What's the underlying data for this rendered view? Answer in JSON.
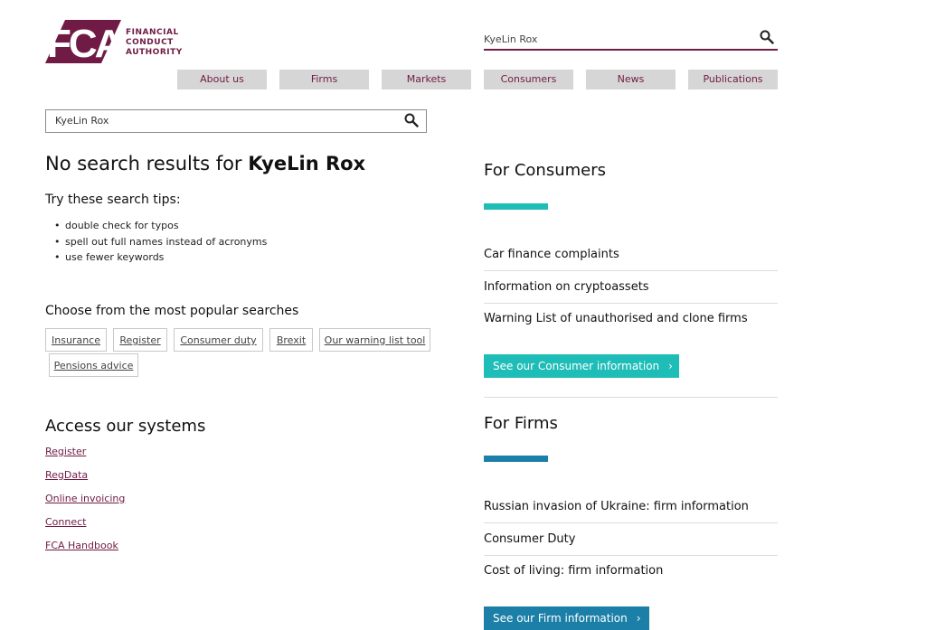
{
  "logo": {
    "mark_text": "FCA",
    "lines": [
      "FINANCIAL",
      "CONDUCT",
      "AUTHORITY"
    ]
  },
  "colors": {
    "brand": "#701b45",
    "consumers_accent": "#1fbdb8",
    "firms_accent": "#1b7fa8",
    "nav_bg": "#d6d6d6"
  },
  "header_search": {
    "value": "KyeLin Rox",
    "icon": "search-icon"
  },
  "nav": [
    {
      "label": "About us"
    },
    {
      "label": "Firms"
    },
    {
      "label": "Markets"
    },
    {
      "label": "Consumers"
    },
    {
      "label": "News"
    },
    {
      "label": "Publications"
    }
  ],
  "main_search": {
    "value": "KyeLin Rox",
    "icon": "search-icon"
  },
  "results": {
    "prefix": "No search results for ",
    "query": "KyeLin Rox"
  },
  "tips": {
    "title": "Try these search tips:",
    "items": [
      "double check for typos",
      "spell out full names instead of acronyms",
      "use fewer keywords"
    ]
  },
  "popular": {
    "title": "Choose from the most popular searches",
    "items": [
      "Insurance",
      "Register",
      "Consumer duty",
      "Brexit",
      "Our warning list tool",
      "Pensions advice"
    ]
  },
  "systems": {
    "title": "Access our systems",
    "links": [
      "Register",
      "RegData",
      "Online invoicing",
      "Connect",
      "FCA Handbook"
    ]
  },
  "consumers": {
    "title": "For Consumers",
    "items": [
      "Car finance complaints",
      "Information on cryptoassets",
      "Warning List of unauthorised and clone firms"
    ],
    "cta": "See our Consumer information"
  },
  "firms": {
    "title": "For Firms",
    "items": [
      "Russian invasion of Ukraine: firm information",
      "Consumer Duty",
      "Cost of living: firm information"
    ],
    "cta": "See our Firm information"
  }
}
